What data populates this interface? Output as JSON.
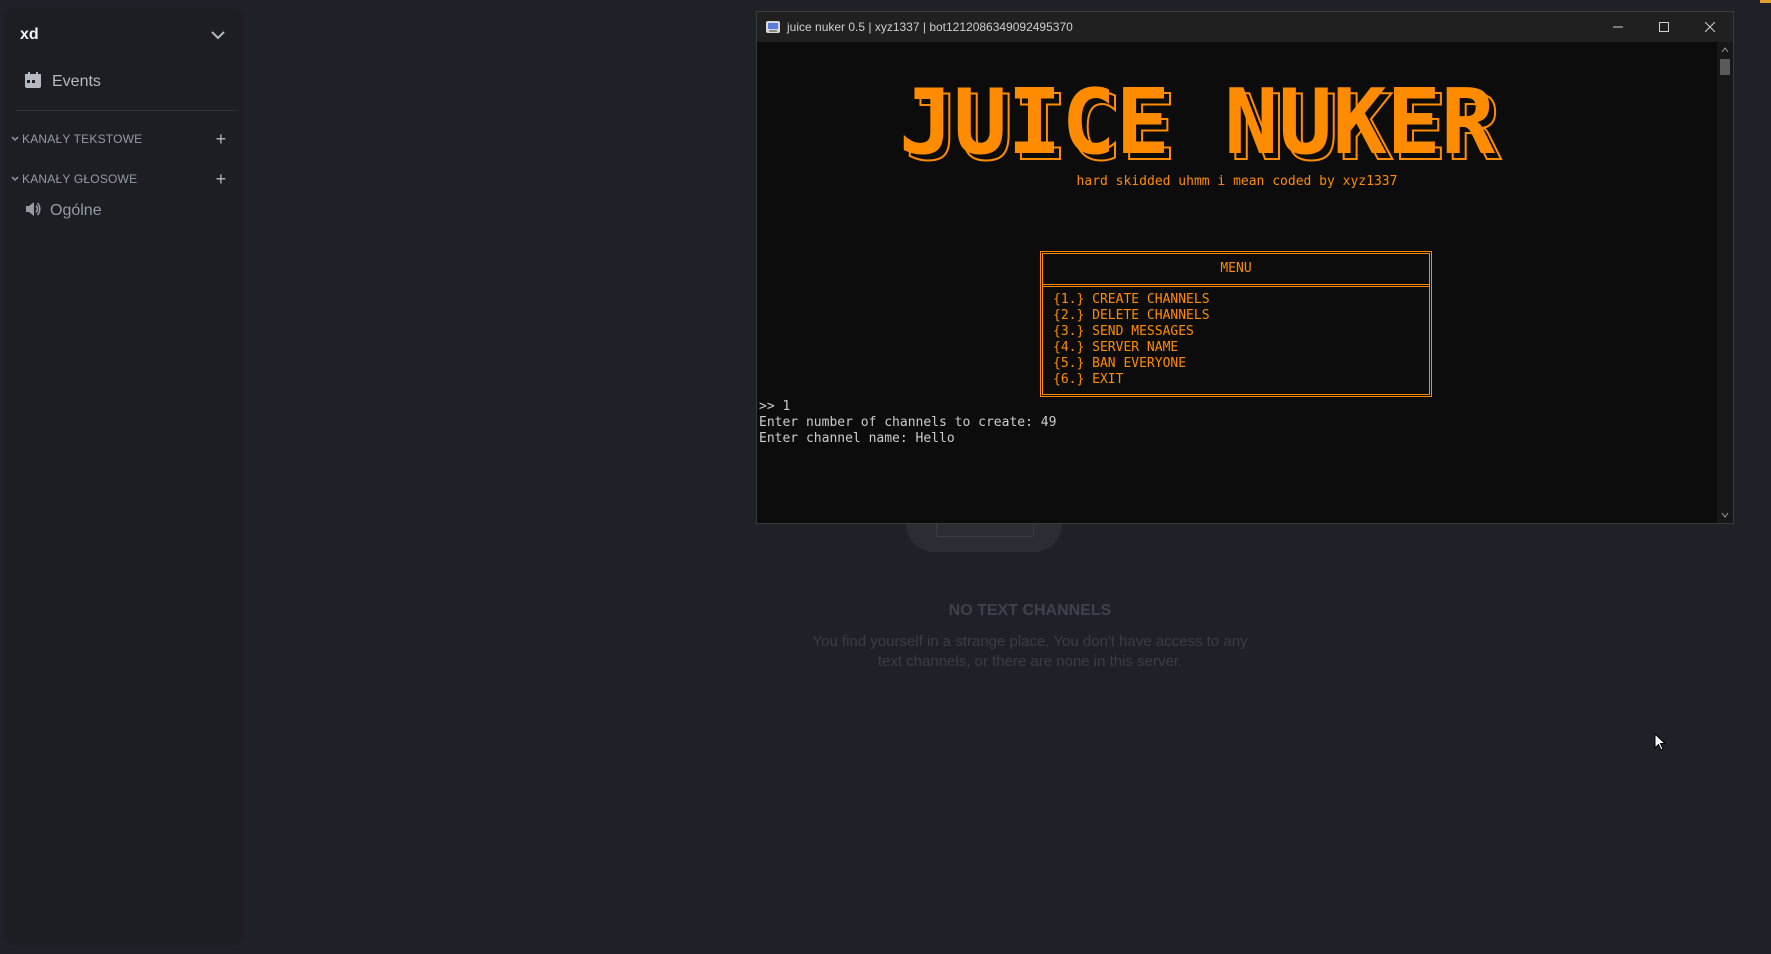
{
  "sidebar": {
    "server_name": "xd",
    "events_label": "Events",
    "categories": [
      {
        "label": "KANAŁY TEKSTOWE"
      },
      {
        "label": "KANAŁY GŁOSOWE"
      }
    ],
    "voice_channels": [
      {
        "label": "Ogólne"
      }
    ]
  },
  "main": {
    "empty_title": "NO TEXT CHANNELS",
    "empty_desc": "You find yourself in a strange place. You don't have access to any text channels, or there are none in this server."
  },
  "console": {
    "title": "juice nuker 0.5 | xyz1337 | bot1212086349092495370",
    "logo_text": "JUICE NUKER",
    "subtitle": "hard skidded uhmm i mean coded by xyz1337",
    "menu_title": "MENU",
    "menu_items": [
      "{1.} CREATE CHANNELS",
      "{2.} DELETE CHANNELS",
      "{3.} SEND MESSAGES",
      "{4.} SERVER NAME",
      "{5.} BAN EVERYONE",
      "{6.} EXIT"
    ],
    "output_lines": [
      ">> 1",
      "Enter number of channels to create: 49",
      "Enter channel name: Hello"
    ]
  },
  "colors": {
    "accent": "#ff8c00",
    "background": "#1f2129",
    "sidebar": "#1c1e24",
    "terminal_bg": "#0c0c0c"
  },
  "icons": [
    "chevron-down-icon",
    "calendar-icon",
    "plus-icon",
    "speaker-icon",
    "minimize-icon",
    "maximize-icon",
    "close-icon",
    "mouse-cursor-icon"
  ]
}
